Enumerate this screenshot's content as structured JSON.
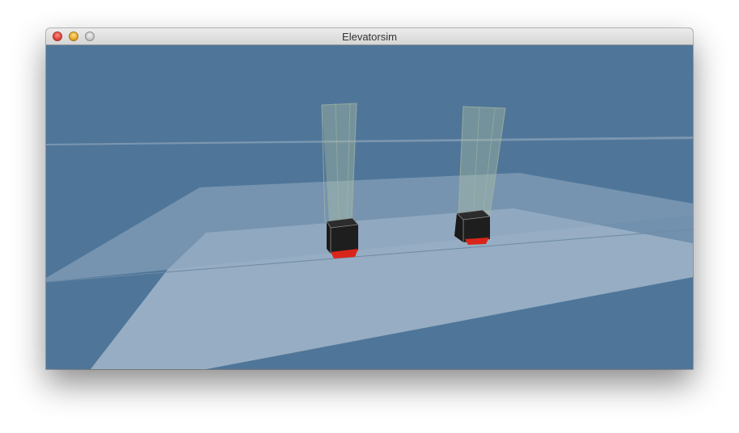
{
  "window": {
    "title": "Elevatorsim"
  },
  "scene": {
    "background_color": "#4f7699",
    "elevator_count": 2,
    "car_color": "#1e1e1e",
    "indicator_color": "#d9261a"
  }
}
